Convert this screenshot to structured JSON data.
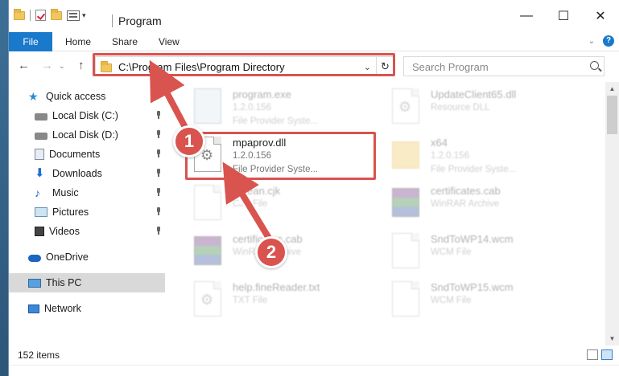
{
  "window": {
    "title": "Program"
  },
  "ribbon": {
    "tabs": [
      "File",
      "Home",
      "Share",
      "View"
    ]
  },
  "address": {
    "path": "C:\\Program Files\\Program Directory"
  },
  "search": {
    "placeholder": "Search Program"
  },
  "nav": {
    "items": [
      {
        "label": "Quick access",
        "icon": "star-icon"
      },
      {
        "label": "Local Disk (C:)",
        "icon": "disk-icon",
        "pinned": true
      },
      {
        "label": "Local Disk (D:)",
        "icon": "disk-icon",
        "pinned": true
      },
      {
        "label": "Documents",
        "icon": "documents-icon",
        "pinned": true
      },
      {
        "label": "Downloads",
        "icon": "downloads-icon",
        "pinned": true
      },
      {
        "label": "Music",
        "icon": "music-icon",
        "pinned": true
      },
      {
        "label": "Pictures",
        "icon": "pictures-icon",
        "pinned": true
      },
      {
        "label": "Videos",
        "icon": "videos-icon",
        "pinned": true
      },
      {
        "label": "OneDrive",
        "icon": "onedrive-icon"
      },
      {
        "label": "This PC",
        "icon": "this-pc-icon",
        "selected": true
      },
      {
        "label": "Network",
        "icon": "network-icon"
      }
    ]
  },
  "files": [
    {
      "name": "program.exe",
      "version": "1.2.0.156",
      "type": "File Provider Syste...",
      "icon": "exe-icon",
      "faded": true
    },
    {
      "name": "UpdateClient65.dll",
      "version": "",
      "type": "Resource DLL",
      "icon": "dll-icon",
      "faded": true
    },
    {
      "name": "mpaprov.dll",
      "version": "1.2.0.156",
      "type": "File Provider Syste...",
      "icon": "dll-icon",
      "faded": false,
      "highlighted": true
    },
    {
      "name": "x64",
      "version": "1.2.0.156",
      "type": "File Provider Syste...",
      "icon": "folder-icon",
      "faded": true
    },
    {
      "name": "corean.cjk",
      "version": "",
      "type": "CJK File",
      "icon": "file-icon",
      "faded": true
    },
    {
      "name": "certificates.cab",
      "version": "",
      "type": "WinRAR Archive",
      "icon": "archive-icon",
      "faded": true
    },
    {
      "name": "certificates.cab",
      "version": "",
      "type": "WinRAR Archive",
      "icon": "archive-icon",
      "faded": true
    },
    {
      "name": "SndToWP14.wcm",
      "version": "",
      "type": "WCM File",
      "icon": "file-icon",
      "faded": true
    },
    {
      "name": "help.fineReader.txt",
      "version": "",
      "type": "TXT File",
      "icon": "file-icon",
      "faded": true
    },
    {
      "name": "SndToWP15.wcm",
      "version": "",
      "type": "WCM File",
      "icon": "file-icon",
      "faded": true
    }
  ],
  "status": {
    "item_count": "152 items"
  },
  "annotations": {
    "step1": "1",
    "step2": "2"
  },
  "colors": {
    "accent": "#1979ca",
    "highlight": "#d9534f"
  }
}
